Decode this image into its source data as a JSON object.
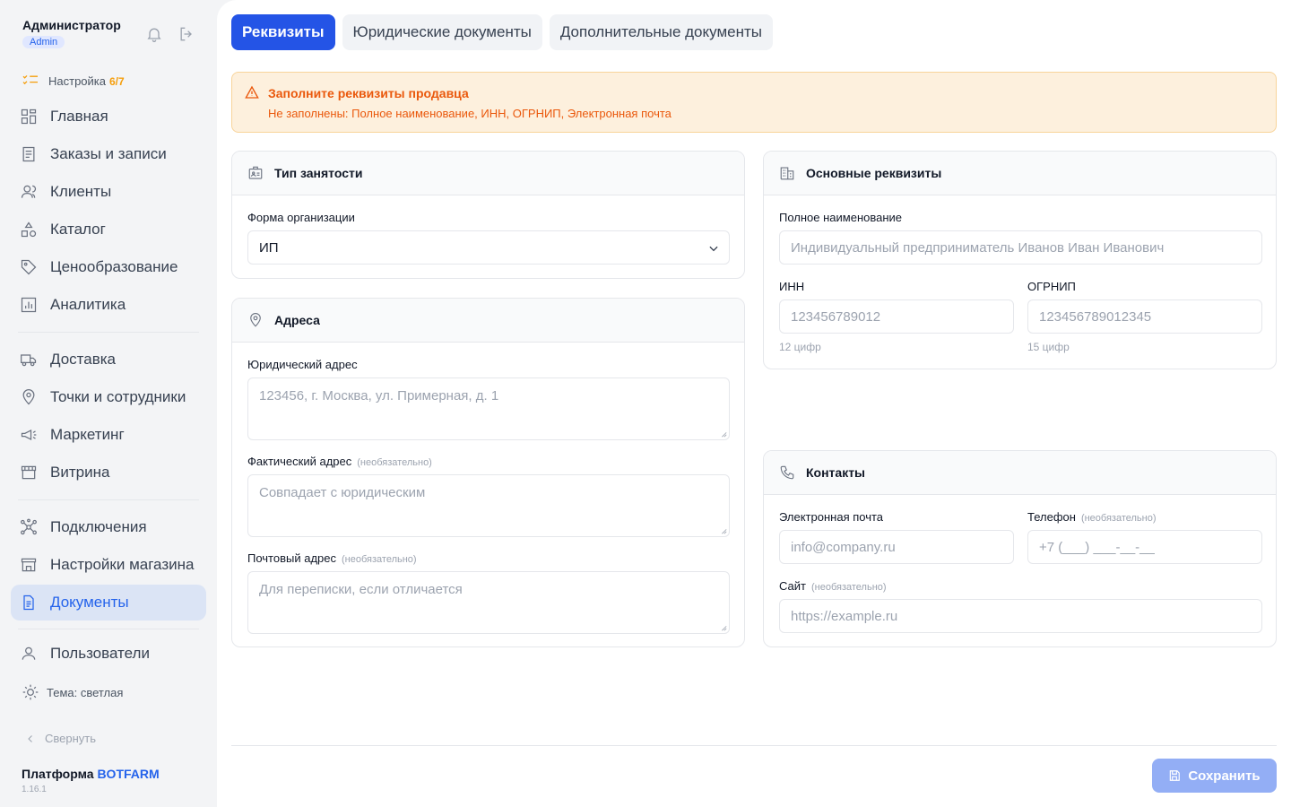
{
  "user": {
    "name": "Администратор",
    "role": "Admin"
  },
  "setup": {
    "label": "Настройка",
    "count": "6/7"
  },
  "nav": {
    "main": [
      "Главная",
      "Заказы и записи",
      "Клиенты",
      "Каталог",
      "Ценообразование",
      "Аналитика"
    ],
    "ops": [
      "Доставка",
      "Точки и сотрудники",
      "Маркетинг",
      "Витрина"
    ],
    "system": [
      "Подключения",
      "Настройки магазина",
      "Документы"
    ],
    "users": "Пользователи"
  },
  "theme": "Тема: светлая",
  "collapse": "Свернуть",
  "platform": {
    "prefix": "Платформа",
    "brand": "BOTFARM",
    "version": "1.16.1"
  },
  "tabs": [
    "Реквизиты",
    "Юридические документы",
    "Дополнительные документы"
  ],
  "alert": {
    "title": "Заполните реквизиты продавца",
    "text": "Не заполнены: Полное наименование, ИНН, ОГРНИП, Электронная почта"
  },
  "employment": {
    "title": "Тип занятости",
    "org_label": "Форма организации",
    "org_value": "ИП"
  },
  "addresses": {
    "title": "Адреса",
    "legal_label": "Юридический адрес",
    "legal_placeholder": "123456, г. Москва, ул. Примерная, д. 1",
    "actual_label": "Фактический адрес",
    "actual_placeholder": "Совпадает с юридическим",
    "postal_label": "Почтовый адрес",
    "postal_placeholder": "Для переписки, если отличается",
    "optional": "(необязательно)"
  },
  "requisites": {
    "title": "Основные реквизиты",
    "fullname_label": "Полное наименование",
    "fullname_placeholder": "Индивидуальный предприниматель Иванов Иван Иванович",
    "inn_label": "ИНН",
    "inn_placeholder": "123456789012",
    "inn_hint": "12 цифр",
    "ogrnip_label": "ОГРНИП",
    "ogrnip_placeholder": "123456789012345",
    "ogrnip_hint": "15 цифр"
  },
  "contacts": {
    "title": "Контакты",
    "email_label": "Электронная почта",
    "email_placeholder": "info@company.ru",
    "phone_label": "Телефон",
    "phone_placeholder": "+7 (___) ___-__-__",
    "site_label": "Сайт",
    "site_placeholder": "https://example.ru",
    "optional": "(необязательно)"
  },
  "save": "Сохранить"
}
